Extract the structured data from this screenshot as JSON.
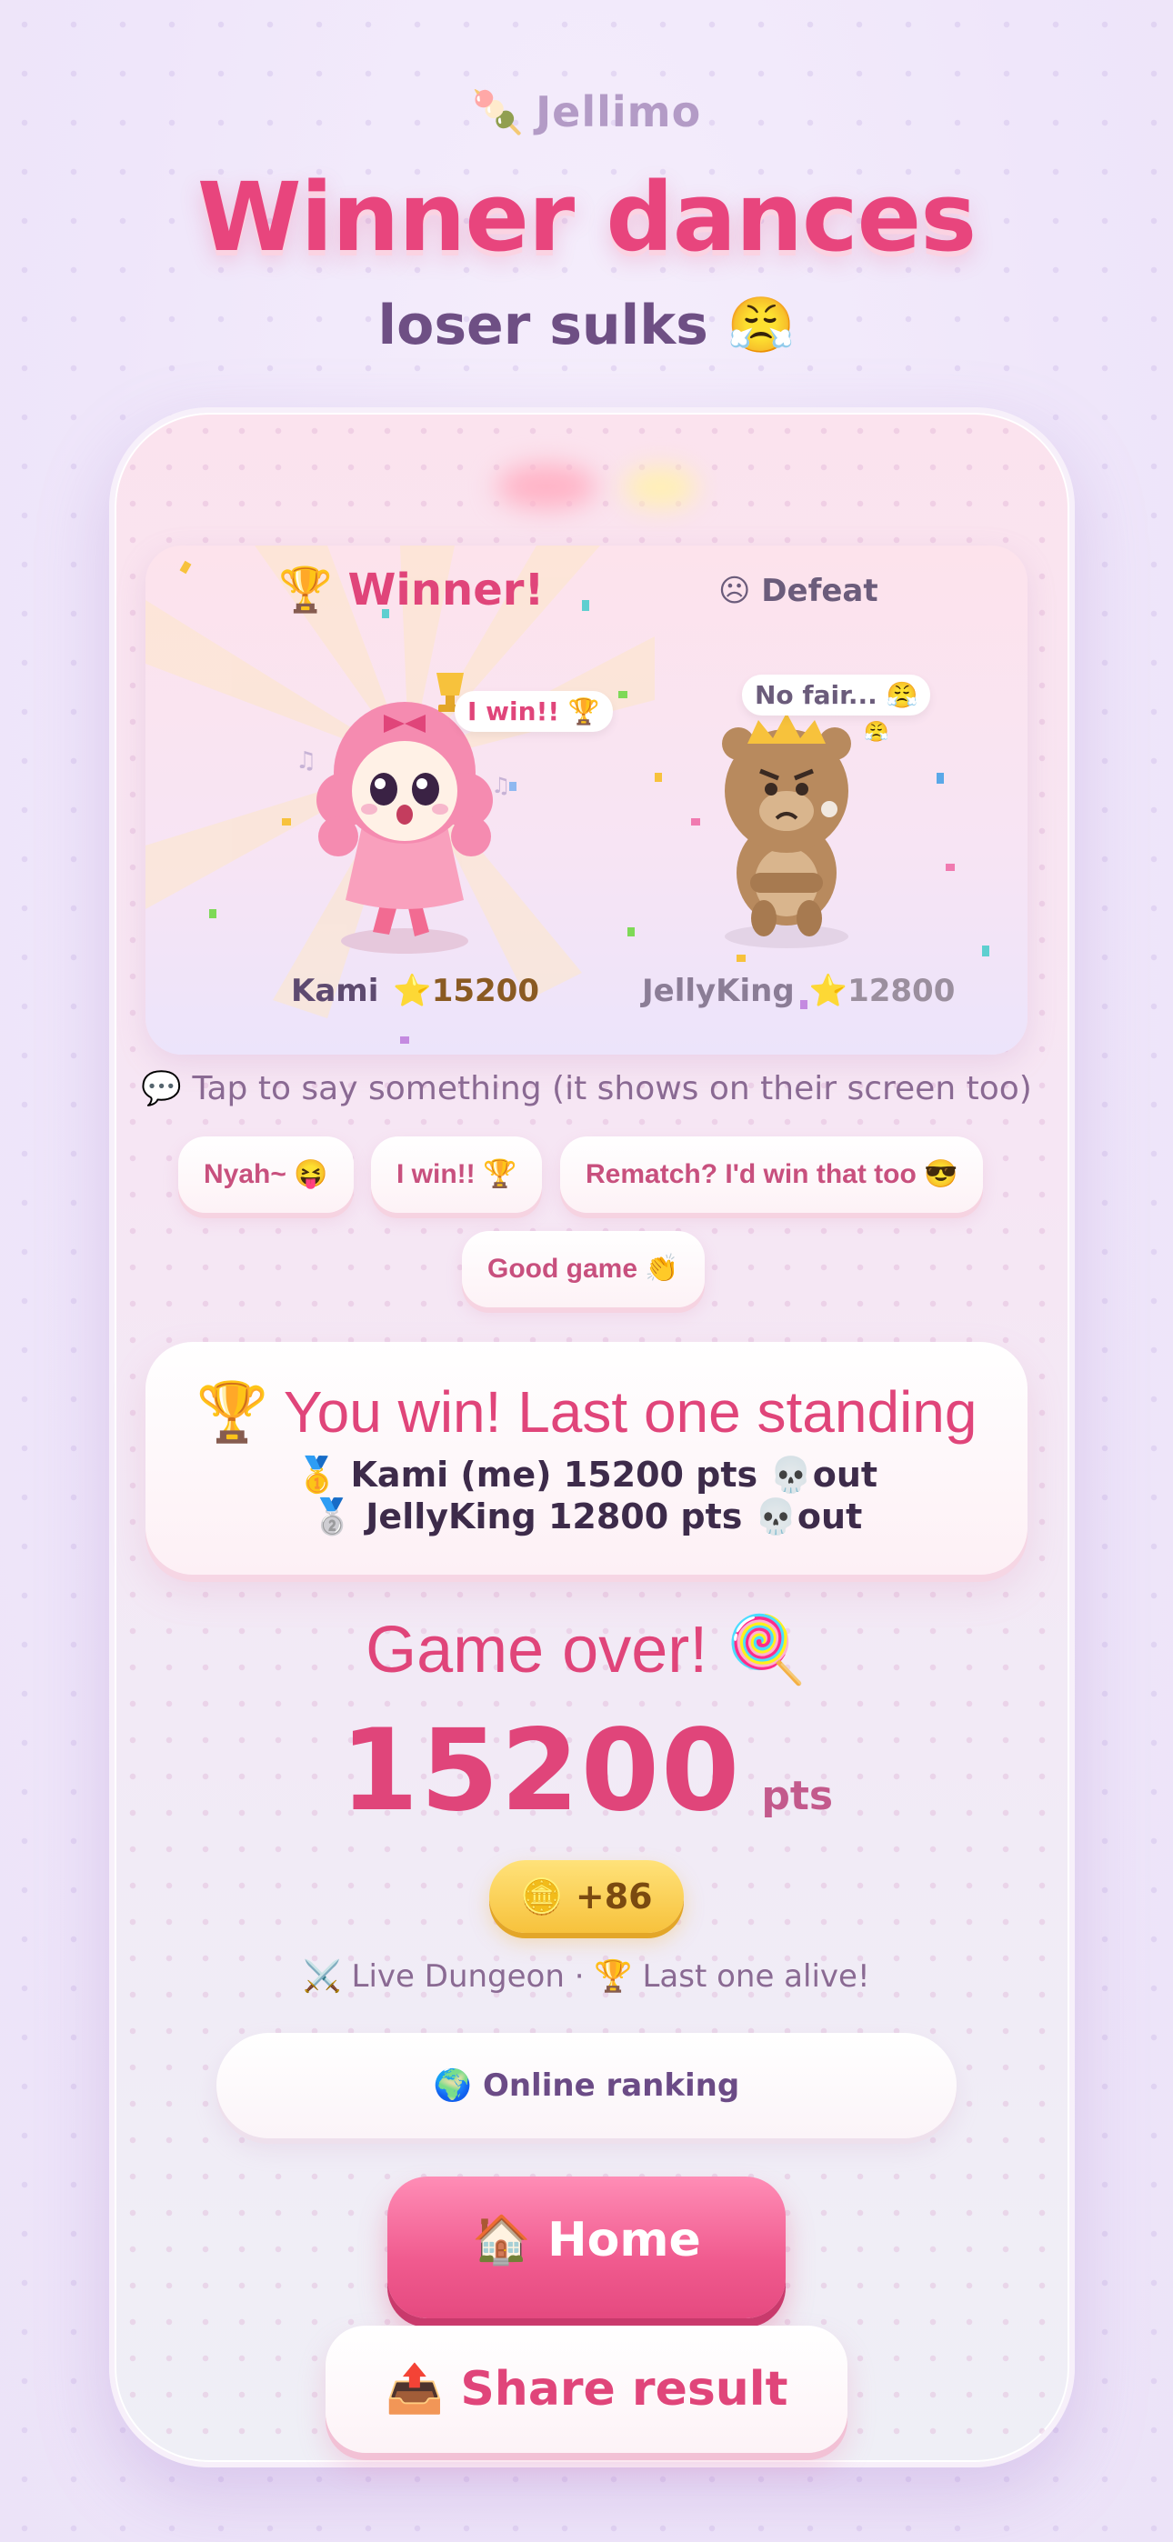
{
  "brand": {
    "icon": "🍡",
    "name": "Jellimo"
  },
  "headline": "Winner dances",
  "subheadline": "loser sulks 😤",
  "battle": {
    "winner_label": "🏆 Winner!",
    "defeat_label": "☹ Defeat",
    "winner_speech": "I win!! 🏆",
    "loser_speech": "No fair... 😤",
    "players": [
      {
        "name": "Kami",
        "score": "⭐15200"
      },
      {
        "name": "JellyKing",
        "score": "⭐12800"
      }
    ]
  },
  "chat_hint": "💬 Tap to say something (it shows on their screen too)",
  "quick_chats": [
    "Nyah~ 😝",
    "I win!! 🏆",
    "Rematch? I'd win that too 😎",
    "Good game 👏"
  ],
  "result": {
    "title": "🏆 You win! Last one standing",
    "lines": [
      "🥇 Kami (me) 15200 pts 💀out",
      "🥈 JellyKing 12800 pts 💀out"
    ]
  },
  "game_over": "Game over! 🍭",
  "final_score": {
    "value": "15200",
    "unit": "pts"
  },
  "coins": "🪙 +86",
  "mode_line": "⚔️ Live Dungeon · 🏆 Last one alive!",
  "buttons": {
    "ranking": "🌍 Online ranking",
    "home": "🏠 Home",
    "share": "📤 Share result"
  },
  "colors": {
    "accent": "#e0457a",
    "gold": "#f7c23c",
    "purple": "#6e4f84"
  }
}
